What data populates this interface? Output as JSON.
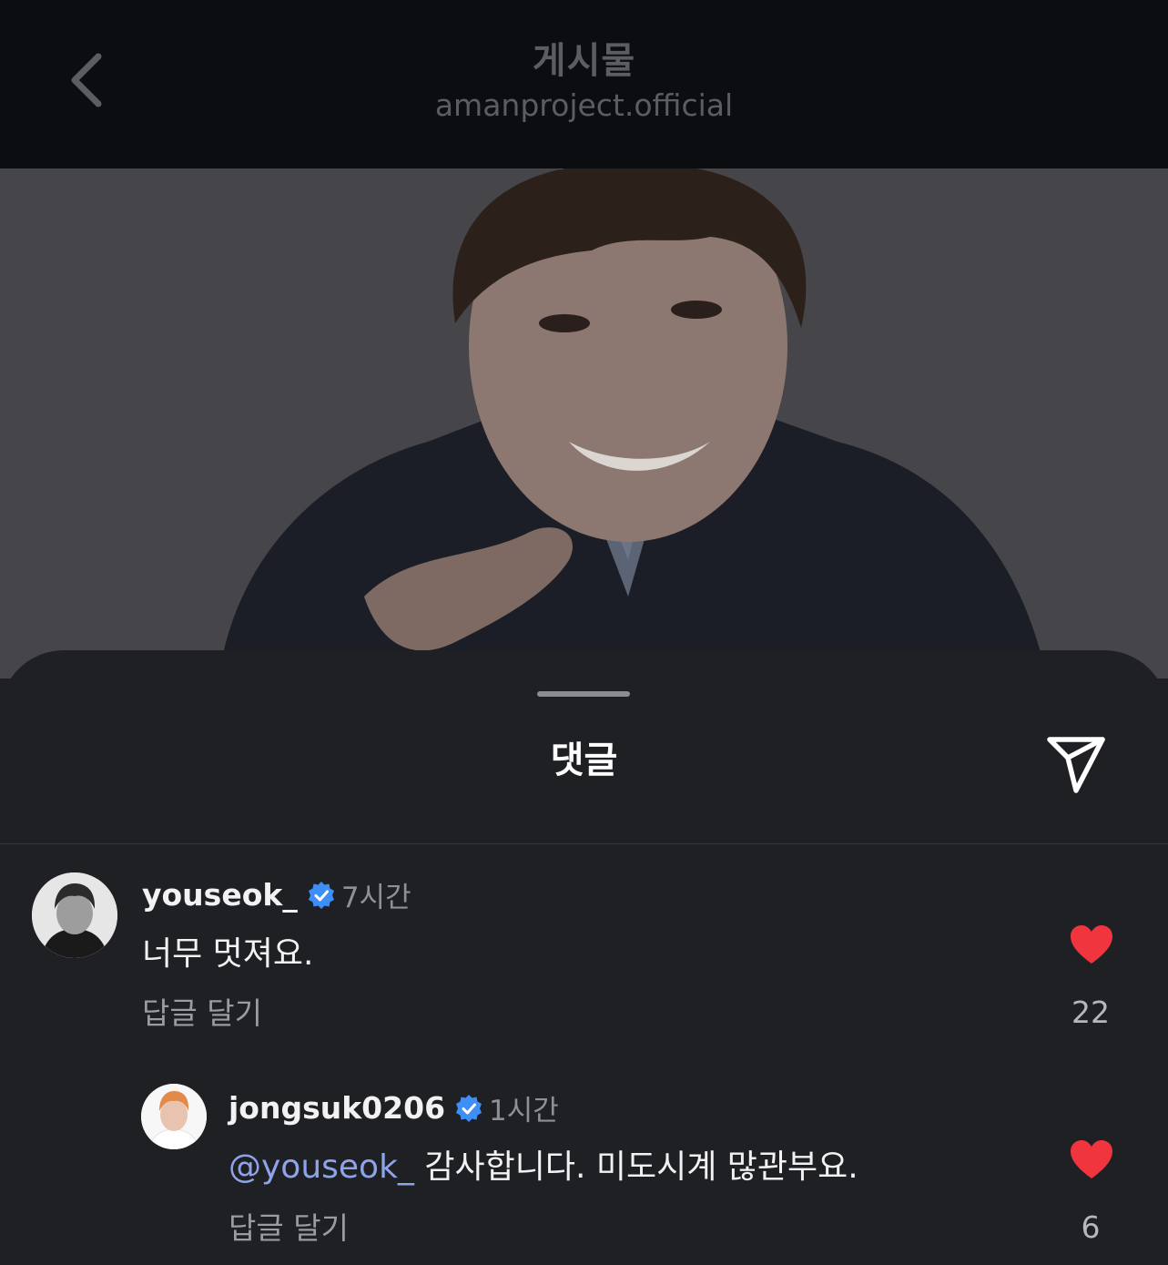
{
  "header": {
    "title": "게시물",
    "subtitle": "amanproject.official"
  },
  "sheet": {
    "title": "댓글"
  },
  "comments": [
    {
      "username": "youseok_",
      "verified": true,
      "time": "7시간",
      "text": "너무 멋져요.",
      "reply_label": "답글 달기",
      "liked": true,
      "like_count": "22",
      "replies": [
        {
          "username": "jongsuk0206",
          "verified": true,
          "time": "1시간",
          "mention": "@youseok_",
          "text": " 감사합니다. 미도시계 많관부요.",
          "reply_label": "답글 달기",
          "liked": true,
          "like_count": "6"
        }
      ]
    }
  ],
  "colors": {
    "like": "#f0353f",
    "verified": "#3e8ef7",
    "mention": "#8ea3e8"
  }
}
